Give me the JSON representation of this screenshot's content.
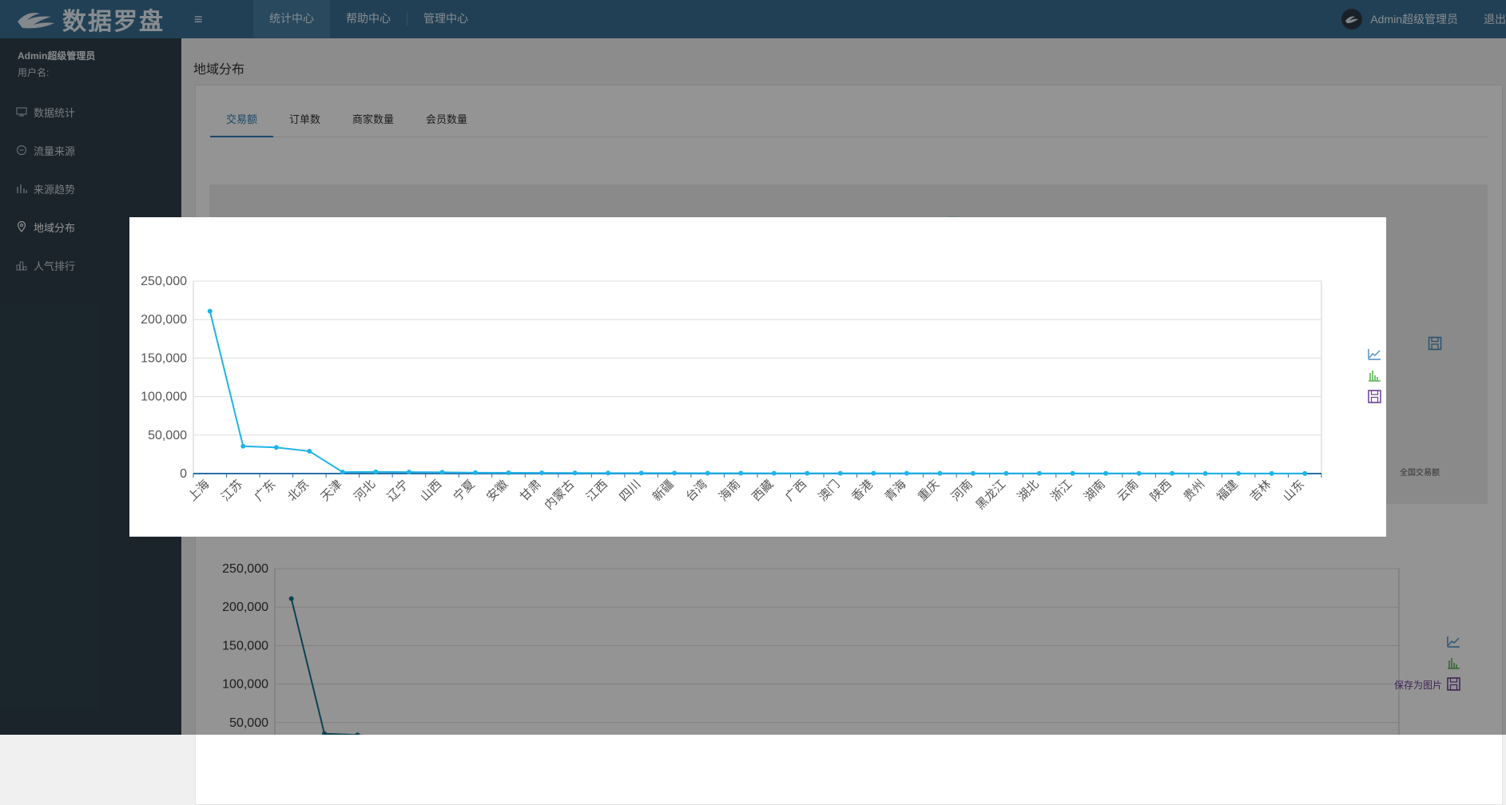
{
  "app": {
    "logo_text": "数据罗盘"
  },
  "topnav": {
    "items": [
      "统计中心",
      "帮助中心",
      "管理中心"
    ]
  },
  "user": {
    "name": "Admin超级管理员",
    "logout": "退出"
  },
  "sidebar": {
    "user_name": "Admin超级管理员",
    "user_label": "用户名:",
    "items": [
      {
        "label": "数据统计",
        "icon": "monitor-icon"
      },
      {
        "label": "流量来源",
        "icon": "circle-icon"
      },
      {
        "label": "来源趋势",
        "icon": "bar-chart-icon"
      },
      {
        "label": "地域分布",
        "icon": "location-icon",
        "active": true
      },
      {
        "label": "人气排行",
        "icon": "ranking-icon"
      }
    ]
  },
  "page": {
    "title": "地域分布",
    "tabs": [
      "交易额",
      "订单数",
      "商家数量",
      "会员数量"
    ],
    "active_tab": 0,
    "map_legend": "全国交易额",
    "save_label": "保存为图片"
  },
  "colors": {
    "accent": "#2f7fb6",
    "line": "#1fb4e8",
    "line_dark": "#15708f",
    "topbar": "#3a6f93",
    "sidebar": "#2f3f4b"
  },
  "chart_data": {
    "type": "line",
    "categories": [
      "上海",
      "江苏",
      "广东",
      "北京",
      "天津",
      "河北",
      "辽宁",
      "山西",
      "宁夏",
      "安徽",
      "甘肃",
      "内蒙古",
      "江西",
      "四川",
      "新疆",
      "台湾",
      "海南",
      "西藏",
      "广西",
      "澳门",
      "香港",
      "青海",
      "重庆",
      "河南",
      "黑龙江",
      "湖北",
      "浙江",
      "湖南",
      "云南",
      "陕西",
      "贵州",
      "福建",
      "吉林",
      "山东"
    ],
    "values": [
      211000,
      35500,
      34000,
      29000,
      2000,
      2200,
      1900,
      1700,
      1200,
      1000,
      900,
      800,
      700,
      650,
      600,
      550,
      500,
      450,
      420,
      400,
      380,
      360,
      340,
      320,
      300,
      280,
      260,
      240,
      220,
      200,
      180,
      160,
      140,
      120
    ],
    "yticks": [
      "0",
      "50,000",
      "100,000",
      "150,000",
      "200,000",
      "250,000"
    ],
    "ylim": [
      0,
      250000
    ]
  }
}
